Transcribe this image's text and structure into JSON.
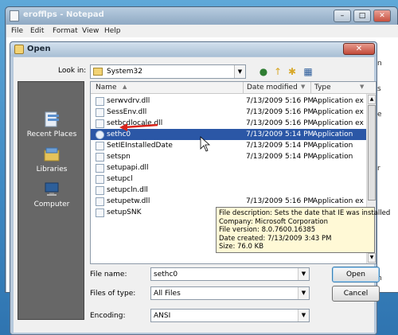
{
  "notepad": {
    "title": "erofflps - Notepad",
    "menu": [
      "File",
      "Edit",
      "Format",
      "View",
      "Help"
    ],
    "controls": [
      "–",
      "□",
      "✕"
    ],
    "fragments": [
      "n",
      "s",
      "e",
      "r",
      "n"
    ]
  },
  "dialog": {
    "title": "Open",
    "close_label": "✕",
    "look_in_label": "Look in:",
    "look_in_value": "System32",
    "places": [
      {
        "label": "Recent Places",
        "icon": "recent-places-icon"
      },
      {
        "label": "Libraries",
        "icon": "libraries-icon"
      },
      {
        "label": "Computer",
        "icon": "computer-icon"
      }
    ],
    "columns": {
      "name": "Name",
      "date": "Date modified",
      "type": "Type"
    },
    "files": [
      {
        "name": "serwvdrv.dll",
        "date": "7/13/2009 5:16 PM",
        "type": "Application exte..."
      },
      {
        "name": "SessEnv.dll",
        "date": "7/13/2009 5:16 PM",
        "type": "Application exte..."
      },
      {
        "name": "setbcdlocale.dll",
        "date": "7/13/2009 5:16 PM",
        "type": "Application exte..."
      },
      {
        "name": "sethc0",
        "date": "7/13/2009 5:14 PM",
        "type": "Application",
        "selected": true
      },
      {
        "name": "SetIEInstalledDate",
        "date": "7/13/2009 5:14 PM",
        "type": "Application"
      },
      {
        "name": "setspn",
        "date": "7/13/2009 5:14 PM",
        "type": "Application"
      },
      {
        "name": "setupapi.dll",
        "date": "",
        "type": ""
      },
      {
        "name": "setupcl",
        "date": "",
        "type": ""
      },
      {
        "name": "setupcln.dll",
        "date": "",
        "type": ""
      },
      {
        "name": "setupetw.dll",
        "date": "7/13/2009 5:16 PM",
        "type": "Application exte..."
      },
      {
        "name": "setupSNK",
        "date": "7/13/2009 5:14 PM",
        "type": "Application"
      }
    ],
    "tooltip": [
      "File description: Sets the date that IE was installed",
      "Company: Microsoft Corporation",
      "File version: 8.0.7600.16385",
      "Date created: 7/13/2009 3:43 PM",
      "Size: 76.0 KB"
    ],
    "file_name_label": "File name:",
    "file_name_value": "sethc0",
    "file_type_label": "Files of type:",
    "file_type_value": "All Files",
    "encoding_label": "Encoding:",
    "encoding_value": "ANSI",
    "open_label": "Open",
    "cancel_label": "Cancel"
  },
  "colors": {
    "selection": "#2b57a6",
    "annotation_arrow": "#d9241c",
    "tooltip_bg": "#fff9d6"
  }
}
